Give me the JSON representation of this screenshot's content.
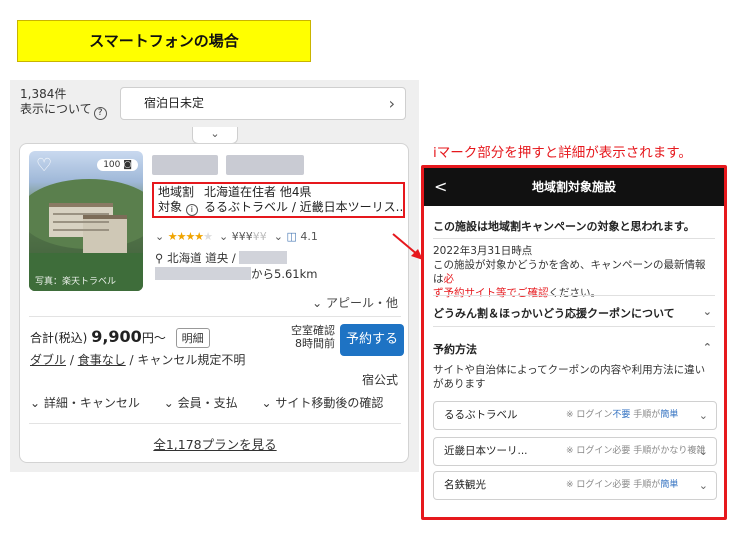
{
  "header_label": "スマートフォンの場合",
  "search_bar": {
    "count": "1,384件",
    "display_about": "表示について",
    "help_icon": "?",
    "date_placeholder": "宿泊日未定"
  },
  "collapse_icon": "chevron-down-icon",
  "card": {
    "photo_count": "100",
    "photo_credit": "写真：楽天トラベル",
    "campaign": {
      "label1": "地域割",
      "label2": "対象",
      "info_icon": "i",
      "line1": "北海道在住者 他4県",
      "line2": "るるぶトラベル / 近畿日本ツーリス..."
    },
    "rating": {
      "stars": "★★★★",
      "star_dim": "★",
      "price_level": "¥¥¥",
      "price_dim": "¥¥",
      "score": "4.1"
    },
    "location": "北海道 道央 /",
    "distance": "から5.61km",
    "appeal": "アピール・他",
    "price_prefix": "合計(税込)",
    "price": "9,900",
    "price_suffix": "円〜",
    "detail_badge": "明細",
    "room_type": "ダブル",
    "meal": "食事なし",
    "cancel": "キャンセル規定不明",
    "vacancy_line1": "空室確認",
    "vacancy_line2": "8時間前",
    "reserve": "予約する",
    "official": "宿公式",
    "link_detail": "詳細・キャンセル",
    "link_member": "会員・支払",
    "link_after": "サイト移動後の確認",
    "plans": "全1,178プランを見る"
  },
  "annotation": "iマーク部分を押すと詳細が表示されます。",
  "detail": {
    "back": "<",
    "title": "地域割対象施設",
    "notice": "この施設は地域割キャンペーンの対象と思われます。",
    "as_of": "2022年3月31日時点",
    "body1": "この施設が対象かどうかを含め、キャンペーンの最新情報は",
    "body_red1": "必",
    "body_red2": "ず予約サイト等でご確認",
    "body2": "ください。",
    "coupon": "どうみん割＆ほっかいどう応援クーポンについて",
    "method_title": "予約方法",
    "method_text": "サイトや自治体によってクーポンの内容や利用方法に違いがあります",
    "sites": [
      {
        "name": "るるぶトラベル",
        "login": "※ ログイン",
        "login_val": "不要",
        "proc": "手順が",
        "proc_val": "簡単"
      },
      {
        "name": "近畿日本ツーリ...",
        "login": "※ ログイン",
        "login_val": "必要",
        "proc": "手順が",
        "proc_val": "かなり複雑"
      },
      {
        "name": "名鉄観光",
        "login": "※ ログイン",
        "login_val": "必要",
        "proc": "手順が",
        "proc_val": "簡単"
      }
    ]
  }
}
